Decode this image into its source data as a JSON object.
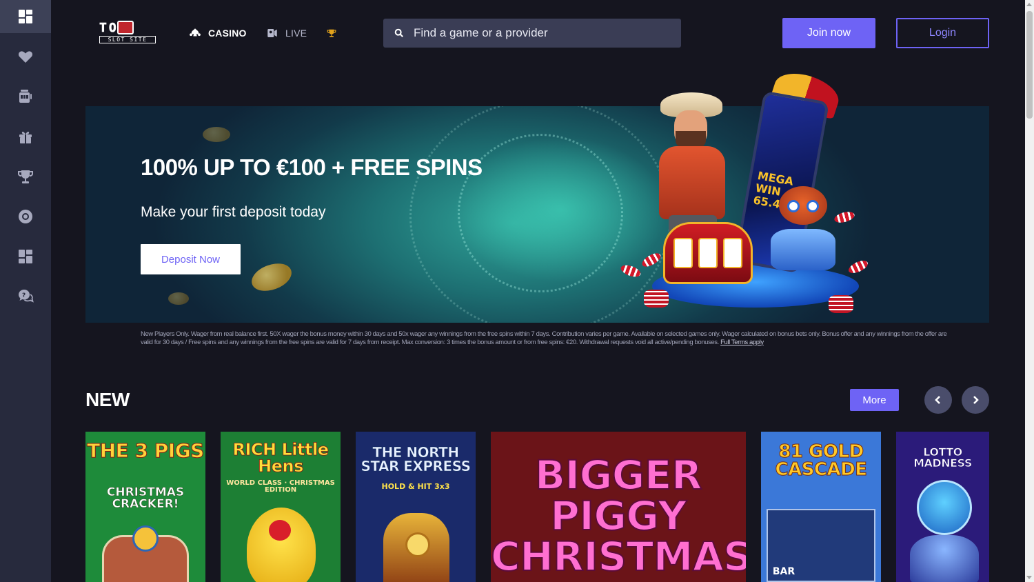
{
  "header": {
    "logo": {
      "top": "TOP",
      "bottom": "SLOT SITE"
    },
    "nav": [
      {
        "label": "CASINO",
        "icon": "cards-icon",
        "active": true
      },
      {
        "label": "LIVE",
        "icon": "live-dealer-icon",
        "active": false
      }
    ],
    "trophy_icon": "trophy-icon",
    "search": {
      "placeholder": "Find a game or a provider",
      "icon": "search-icon"
    },
    "join_label": "Join now",
    "login_label": "Login"
  },
  "sidebar": {
    "items": [
      {
        "icon": "dashboard-icon",
        "active": true
      },
      {
        "icon": "heart-icon",
        "active": false
      },
      {
        "icon": "slot-machine-icon",
        "active": false
      },
      {
        "icon": "gift-icon",
        "active": false
      },
      {
        "icon": "trophy-icon",
        "active": false
      },
      {
        "icon": "lifebuoy-icon",
        "active": false
      },
      {
        "icon": "dashboard-icon",
        "active": false
      },
      {
        "icon": "help-chat-icon",
        "active": false
      }
    ]
  },
  "banner": {
    "title": "100% UP TO €100 + FREE SPINS",
    "subtitle": "Make your first deposit today",
    "cta_label": "Deposit Now",
    "phone_text": "MEGA WIN 65.45",
    "terms_text": "New Players Only. Wager from real balance first. 50X wager the bonus money within 30 days and 50x wager any winnings from the free spins within 7 days. Contribution varies per game. Available on selected games only. Wager calculated on bonus bets only. Bonus offer and any winnings from the offer are valid for 30 days / Free spins and any winnings from the free spins are valid for 7 days from receipt. Max conversion: 3 times the bonus amount or from free spins: €20. Withdrawal requests void all active/pending bonuses.",
    "terms_link": "Full Terms apply"
  },
  "new_section": {
    "title": "NEW",
    "more_label": "More",
    "games": [
      {
        "title": "THE 3 PIGS",
        "subtitle": "CHRISTMAS CRACKER!",
        "bg": "#1e8b3a",
        "title_color": "#ffd23a"
      },
      {
        "title": "RICH Little Hens",
        "subtitle": "WORLD CLASS · CHRISTMAS EDITION",
        "bg": "#1d7f34",
        "title_color": "#ffdf3a"
      },
      {
        "title": "THE NORTH STAR EXPRESS",
        "subtitle": "HOLD & HIT 3x3",
        "bg": "#1a2a6a",
        "title_color": "#e9f1ff"
      },
      {
        "title": "BIGGER PIGGY CHRISTMAS",
        "subtitle": "",
        "bg": "#6b1418",
        "title_color": "#ff6fd1"
      },
      {
        "title": "81 GOLD CASCADE",
        "subtitle": "BAR",
        "bg": "#3b78d8",
        "title_color": "#ffc928"
      },
      {
        "title": "LOTTO MADNESS",
        "subtitle": "",
        "bg": "#2b1b7a",
        "title_color": "#ffffff"
      }
    ]
  },
  "colors": {
    "accent": "#6e63f5",
    "sidebar_bg": "#272a3d",
    "page_bg": "#15151f",
    "search_bg": "#3a3d55"
  }
}
